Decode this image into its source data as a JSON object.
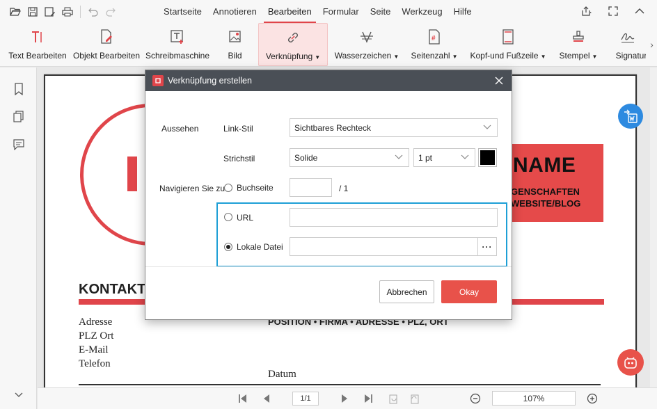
{
  "menu": {
    "items": [
      "Startseite",
      "Annotieren",
      "Bearbeiten",
      "Formular",
      "Seite",
      "Werkzeug",
      "Hilfe"
    ],
    "active_index": 2
  },
  "ribbon": {
    "items": [
      {
        "label": "Text Bearbeiten",
        "icon": "text-edit-icon"
      },
      {
        "label": "Objekt Bearbeiten",
        "icon": "object-edit-icon"
      },
      {
        "label": "Schreibmaschine",
        "icon": "typewriter-icon"
      },
      {
        "label": "Bild",
        "icon": "image-icon"
      },
      {
        "label": "Verknüpfung",
        "icon": "link-icon",
        "dropdown": true,
        "selected": true
      },
      {
        "label": "Wasserzeichen",
        "icon": "watermark-icon",
        "dropdown": true
      },
      {
        "label": "Seitenzahl",
        "icon": "page-number-icon",
        "dropdown": true
      },
      {
        "label": "Kopf-und Fußzeile",
        "icon": "header-footer-icon",
        "dropdown": true
      },
      {
        "label": "Stempel",
        "icon": "stamp-icon",
        "dropdown": true
      },
      {
        "label": "Signatur",
        "icon": "signature-icon"
      }
    ]
  },
  "document": {
    "name_title": "NAME",
    "name_line1": "GENSCHAFTEN",
    "name_line2": "WEBSITE/BLOG",
    "kontakt_heading": "KONTAKT",
    "contact_lines": [
      "Adresse",
      "PLZ Ort",
      "E-Mail",
      "Telefon"
    ],
    "position_line": "POSITION • FIRMA • ADRESSE • PLZ, ORT",
    "datum": "Datum"
  },
  "dialog": {
    "title": "Verknüpfung erstellen",
    "aussehen_label": "Aussehen",
    "link_stil_label": "Link-Stil",
    "link_stil_value": "Sichtbares Rechteck",
    "strichstil_label": "Strichstil",
    "strichstil_value": "Solide",
    "width_value": "1 pt",
    "color": "#000000",
    "navigate_label": "Navigieren Sie zu",
    "buchseite_label": "Buchseite",
    "page_total": "/ 1",
    "url_label": "URL",
    "lokale_datei_label": "Lokale Datei",
    "browse_label": "···",
    "cancel_label": "Abbrechen",
    "ok_label": "Okay",
    "selected_option": "Lokale Datei"
  },
  "statusbar": {
    "page_indicator": "1/1",
    "zoom": "107%"
  },
  "colors": {
    "accent": "#e0454a",
    "highlight": "#1e9fd6",
    "ok_button": "#e8524a"
  }
}
